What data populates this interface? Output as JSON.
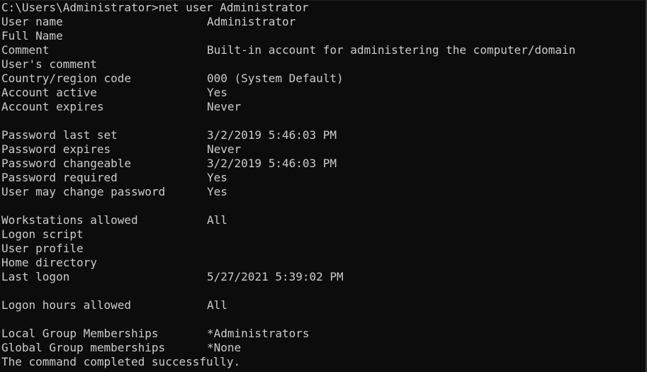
{
  "colors": {
    "background": "#0c0c0c",
    "text": "#cccccc"
  },
  "console": {
    "prompt": "C:\\Users\\Administrator>",
    "command": "net user Administrator",
    "rows": [
      {
        "key": "User name",
        "value": "Administrator"
      },
      {
        "key": "Full Name",
        "value": ""
      },
      {
        "key": "Comment",
        "value": "Built-in account for administering the computer/domain"
      },
      {
        "key": "User's comment",
        "value": ""
      },
      {
        "key": "Country/region code",
        "value": "000 (System Default)"
      },
      {
        "key": "Account active",
        "value": "Yes"
      },
      {
        "key": "Account expires",
        "value": "Never"
      },
      {
        "key": "",
        "value": ""
      },
      {
        "key": "Password last set",
        "value": "3/2/2019 5:46:03 PM"
      },
      {
        "key": "Password expires",
        "value": "Never"
      },
      {
        "key": "Password changeable",
        "value": "3/2/2019 5:46:03 PM"
      },
      {
        "key": "Password required",
        "value": "Yes"
      },
      {
        "key": "User may change password",
        "value": "Yes"
      },
      {
        "key": "",
        "value": ""
      },
      {
        "key": "Workstations allowed",
        "value": "All"
      },
      {
        "key": "Logon script",
        "value": ""
      },
      {
        "key": "User profile",
        "value": ""
      },
      {
        "key": "Home directory",
        "value": ""
      },
      {
        "key": "Last logon",
        "value": "5/27/2021 5:39:02 PM"
      },
      {
        "key": "",
        "value": ""
      },
      {
        "key": "Logon hours allowed",
        "value": "All"
      },
      {
        "key": "",
        "value": ""
      },
      {
        "key": "Local Group Memberships",
        "value": "*Administrators"
      },
      {
        "key": "Global Group memberships",
        "value": "*None"
      }
    ],
    "status": "The command completed successfully."
  }
}
